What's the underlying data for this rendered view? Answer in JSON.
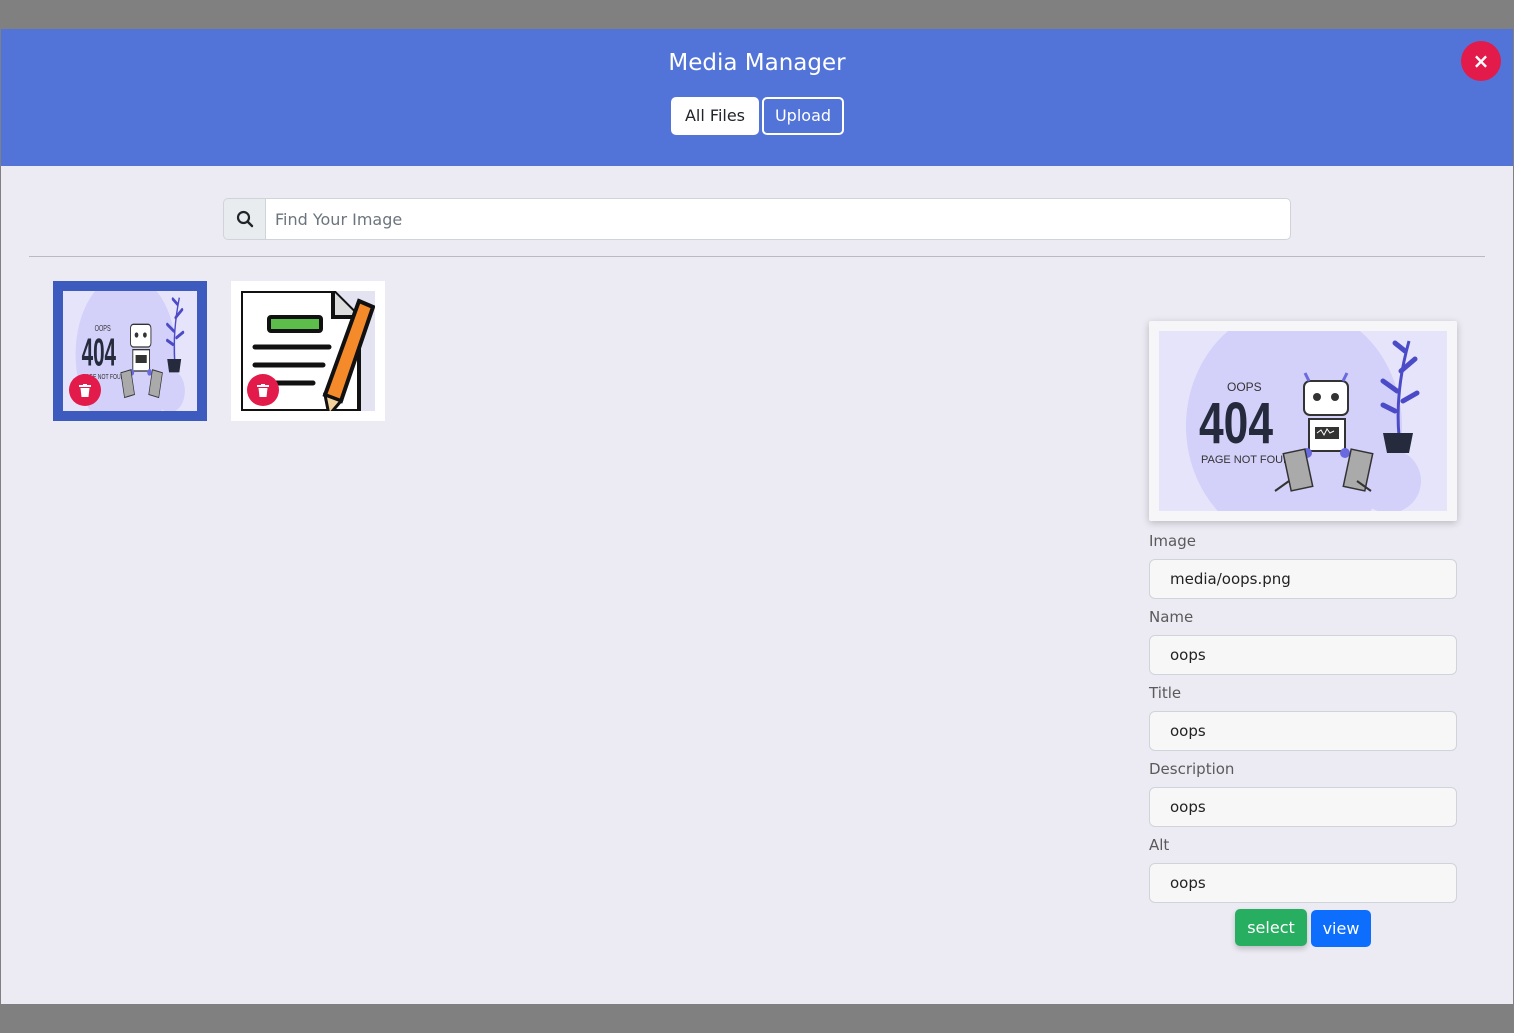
{
  "header": {
    "title": "Media Manager",
    "tabs": [
      {
        "label": "All Files",
        "active": true
      },
      {
        "label": "Upload",
        "active": false
      }
    ],
    "close_label": "×"
  },
  "search": {
    "placeholder": "Find Your Image",
    "value": ""
  },
  "images": [
    {
      "name": "oops",
      "thumb_icon": "404-robot-illustration",
      "selected": true
    },
    {
      "name": "document",
      "thumb_icon": "document-pen-illustration",
      "selected": false
    }
  ],
  "illustration": {
    "small_text": "OOPS",
    "big_text": "404",
    "caption": "PAGE NOT FOUND"
  },
  "details": {
    "fields": [
      {
        "label": "Image",
        "value": "media/oops.png"
      },
      {
        "label": "Name",
        "value": "oops"
      },
      {
        "label": "Title",
        "value": "oops"
      },
      {
        "label": "Description",
        "value": "oops"
      },
      {
        "label": "Alt",
        "value": "oops"
      }
    ],
    "select_label": "select",
    "view_label": "view"
  },
  "colors": {
    "header": "#5274d8",
    "danger": "#e21b4a",
    "success": "#27ae60",
    "primary": "#0d6efd",
    "selected_border": "#3d5bbf"
  }
}
